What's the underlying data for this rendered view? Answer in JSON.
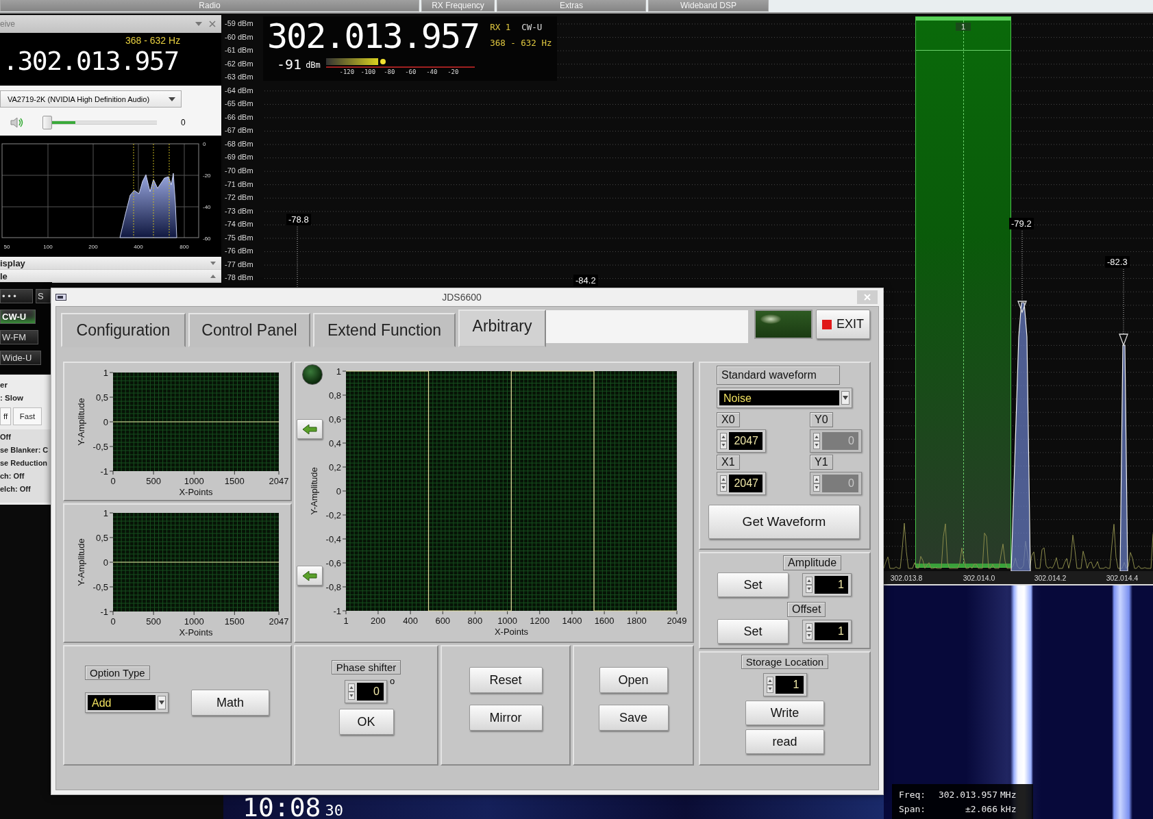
{
  "menu_tabs": [
    {
      "label": "Radio"
    },
    {
      "label": "RX Frequency"
    },
    {
      "label": "Extras"
    },
    {
      "label": "Wideband DSP"
    }
  ],
  "receive_panel": {
    "title": "eive",
    "filter_range": "368 - 632 Hz",
    "frequency": ".302.013.957",
    "audio_device": "VA2719-2K (NVIDIA High Definition Audio)",
    "volume": {
      "level": 0,
      "reading": "0"
    },
    "audio_meter": {
      "level": 0.29
    },
    "audio_spectrum": {
      "x_labels": [
        "50",
        "100",
        "200",
        "400",
        "800"
      ],
      "y_labels": [
        "0",
        "-20",
        "-40",
        "-60"
      ]
    },
    "sections": [
      {
        "label": "isplay",
        "expanded": false
      },
      {
        "label": "le",
        "expanded": true
      }
    ]
  },
  "mode_panel": {
    "buttons": [
      {
        "label": "• • •",
        "selected": false
      },
      {
        "label": "CW-U",
        "selected": true
      },
      {
        "label": "W-FM",
        "selected": false
      },
      {
        "label": "Wide-U",
        "selected": false
      }
    ],
    "side_button": "S",
    "agc_title": "er",
    "agc_value": ": Slow",
    "agc_buttons": [
      "ff",
      "Fast"
    ],
    "status_lines": [
      "Off",
      "se Blanker: C",
      "se Reduction",
      "ch: Off",
      "elch: Off"
    ]
  },
  "spectrum": {
    "dbm_scale": [
      "-59 dBm",
      "-60 dBm",
      "-61 dBm",
      "-62 dBm",
      "-63 dBm",
      "-64 dBm",
      "-65 dBm",
      "-66 dBm",
      "-67 dBm",
      "-68 dBm",
      "-69 dBm",
      "-70 dBm",
      "-71 dBm",
      "-72 dBm",
      "-73 dBm",
      "-74 dBm",
      "-75 dBm",
      "-76 dBm",
      "-77 dBm",
      "-78 dBm"
    ],
    "frequency": "302.013.957",
    "receiver": "RX 1",
    "mode": "CW-U",
    "filter_range": "368 - 632 Hz",
    "signal_reading": "-91",
    "signal_unit": "dBm",
    "signal_meter": {
      "level": 0.35,
      "ticks": [
        "-120",
        "-100",
        "-80",
        "-60",
        "-40",
        "-20"
      ]
    },
    "peaks": [
      "-78.8",
      "-84.2",
      "-79.2",
      "-82.3"
    ],
    "passband_label": "1",
    "freq_labels": [
      "302.013.8",
      "302.014.0",
      "302.014.2",
      "302.014.4"
    ]
  },
  "waterfall": {
    "freq_label": "Freq:",
    "freq": "302.013.957",
    "freq_unit": "MHz",
    "span_label": "Span:",
    "span": "±2.066",
    "span_unit": "kHz"
  },
  "clock": {
    "time": "10:08",
    "seconds": "30"
  },
  "jds": {
    "title": "JDS6600",
    "tabs": [
      {
        "label": "Configuration",
        "selected": false
      },
      {
        "label": "Control Panel",
        "selected": false
      },
      {
        "label": "Extend Function",
        "selected": false
      },
      {
        "label": "Arbitrary",
        "selected": true
      }
    ],
    "exit": "EXIT",
    "plots": [
      {
        "chart_data": {
          "type": "line",
          "xlabel": "X-Points",
          "ylabel": "Y-Amplitude",
          "x": [
            0,
            2047
          ],
          "grid": true,
          "series": [
            {
              "color": "#e8e0a0",
              "values": [
                0,
                0
              ]
            }
          ],
          "xlim": [
            0,
            2047
          ],
          "ylim": [
            -1,
            1
          ],
          "xticks": [
            0,
            500,
            1000,
            1500,
            2047
          ],
          "yticks": [
            -1,
            {
              "value": -0.5,
              "label": "-0,5"
            },
            0,
            {
              "value": 0.5,
              "label": "0,5"
            },
            1
          ]
        }
      },
      {
        "chart_data": {
          "type": "line",
          "xlabel": "X-Points",
          "ylabel": "Y-Amplitude",
          "x": [
            0,
            2047
          ],
          "grid": true,
          "series": [
            {
              "color": "#e8e0a0",
              "values": [
                0,
                0
              ]
            }
          ],
          "xlim": [
            0,
            2047
          ],
          "ylim": [
            -1,
            1
          ],
          "xticks": [
            0,
            500,
            1000,
            1500,
            2047
          ],
          "yticks": [
            -1,
            {
              "value": -0.5,
              "label": "-0,5"
            },
            0,
            {
              "value": 0.5,
              "label": "0,5"
            },
            1
          ]
        }
      },
      {
        "chart_data": {
          "type": "line",
          "xlabel": "X-Points",
          "ylabel": "Y-Amplitude",
          "x": [
            1,
            512,
            512,
            1024,
            1024,
            1536,
            1536,
            2049
          ],
          "grid": true,
          "series": [
            {
              "color": "#e8e0a0",
              "values": [
                1,
                1,
                -1,
                -1,
                1,
                1,
                -1,
                -1
              ]
            }
          ],
          "xlim": [
            1,
            2049
          ],
          "ylim": [
            -1,
            1
          ],
          "xticks": [
            1,
            200,
            400,
            600,
            800,
            1000,
            1200,
            1400,
            1600,
            1800,
            2049
          ],
          "yticks": [
            -1,
            {
              "value": -0.8,
              "label": "-0,8"
            },
            {
              "value": -0.6,
              "label": "-0,6"
            },
            {
              "value": -0.4,
              "label": "-0,4"
            },
            {
              "value": -0.2,
              "label": "-0,2"
            },
            0,
            {
              "value": 0.2,
              "label": "0,2"
            },
            {
              "value": 0.4,
              "label": "0,4"
            },
            {
              "value": 0.6,
              "label": "0,6"
            },
            {
              "value": 0.8,
              "label": "0,8"
            },
            1
          ]
        }
      }
    ],
    "option_type": {
      "label": "Option Type",
      "value": "Add"
    },
    "math": "Math",
    "phase": {
      "label": "Phase shifter",
      "value": "0",
      "unit": "o"
    },
    "ok": "OK",
    "reset": "Reset",
    "mirror": "Mirror",
    "open": "Open",
    "save": "Save",
    "waveform": {
      "label": "Standard waveform",
      "value": "Noise"
    },
    "coords": [
      {
        "label": "X0",
        "value": "2047",
        "disabled": false
      },
      {
        "label": "Y0",
        "value": "0",
        "disabled": true
      },
      {
        "label": "X1",
        "value": "2047",
        "disabled": false
      },
      {
        "label": "Y1",
        "value": "0",
        "disabled": true
      }
    ],
    "get_waveform": "Get Waveform",
    "amplitude": {
      "label": "Amplitude",
      "button": "Set",
      "value": "1"
    },
    "offset": {
      "label": "Offset",
      "button": "Set",
      "value": "1"
    },
    "storage": {
      "label": "Storage Location",
      "value": "1",
      "write": "Write",
      "read": "read"
    }
  }
}
